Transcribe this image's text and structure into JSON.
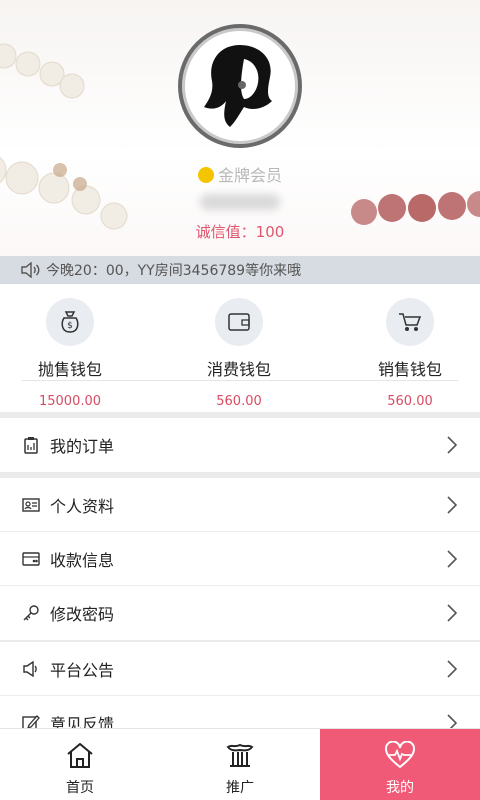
{
  "profile": {
    "member_level": "金牌会员",
    "credit_label": "诚信值：100"
  },
  "notice": {
    "text": "今晚20：00，YY房间3456789等你来哦"
  },
  "wallets": [
    {
      "name": "抛售钱包",
      "amount": "15000.00",
      "icon": "money-bag-icon"
    },
    {
      "name": "消费钱包",
      "amount": "560.00",
      "icon": "wallet-icon"
    },
    {
      "name": "销售钱包",
      "amount": "560.00",
      "icon": "cart-icon"
    }
  ],
  "menu": {
    "orders": "我的订单",
    "profile": "个人资料",
    "payment": "收款信息",
    "password": "修改密码",
    "announcement": "平台公告",
    "feedback": "意见反馈"
  },
  "tabs": [
    {
      "label": "首页",
      "icon": "home-icon"
    },
    {
      "label": "推广",
      "icon": "promote-icon"
    },
    {
      "label": "我的",
      "icon": "heartbeat-icon",
      "active": true
    }
  ],
  "colors": {
    "accent": "#f05a77",
    "amount": "#d94b63",
    "notice_bg": "#d7dbe2"
  }
}
